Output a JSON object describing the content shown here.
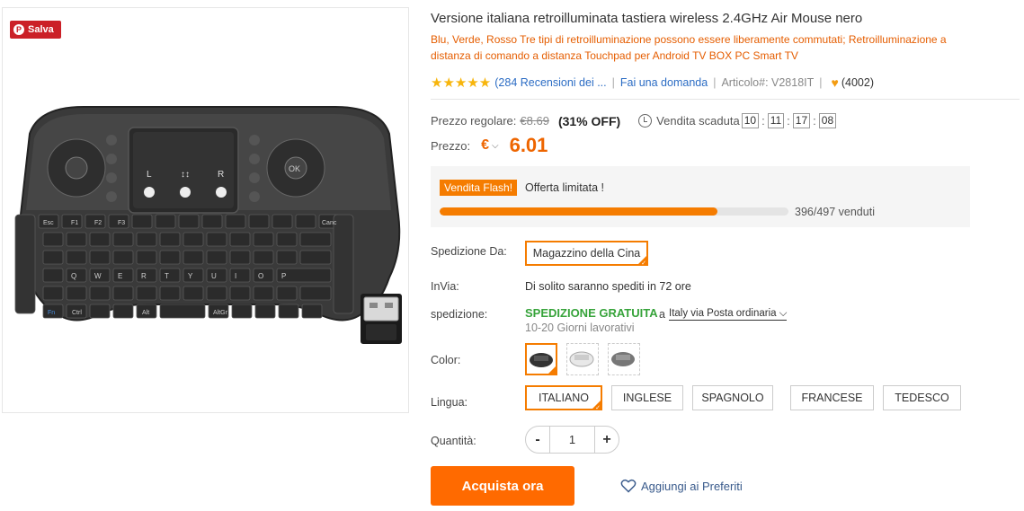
{
  "pin": {
    "label": "Salva",
    "icon": "pinterest-icon"
  },
  "product": {
    "title": "Versione italiana retroilluminata tastiera wireless 2.4GHz Air Mouse nero",
    "subtitle": "Blu, Verde, Rosso Tre tipi di retroilluminazione possono essere liberamente commutati; Retroilluminazione a distanza di comando a distanza Touchpad per Android TV BOX PC Smart TV",
    "stars": "★★★★★",
    "reviews": "(284 Recensioni dei ...",
    "ask": "Fai una domanda",
    "sku": "Articolo#: V2818IT",
    "favorites_count": "(4002)"
  },
  "pricing": {
    "regular_label": "Prezzo regolare:",
    "regular_price": "€8.69",
    "discount": "(31% OFF)",
    "countdown_label": "Vendita scaduta",
    "countdown": [
      "10",
      "11",
      "17",
      "08"
    ],
    "price_label": "Prezzo:",
    "currency": "€",
    "price": "6.01"
  },
  "flash": {
    "badge": "Vendita Flash!",
    "text": "Offerta limitata !",
    "sold": 396,
    "total": 497,
    "progress_text": "396/497  venduti"
  },
  "options": {
    "shipfrom_label": "Spedizione Da:",
    "shipfrom_value": "Magazzino della Cina",
    "invia_label": "InVia:",
    "invia_value": "Di solito saranno spediti in 72 ore",
    "shipping_label": "spedizione:",
    "shipping_free": "SPEDIZIONE GRATUITA",
    "shipping_a": "a",
    "shipping_method": "Italy via Posta ordinaria",
    "shipping_days": "10-20 Giorni lavorativi",
    "color_label": "Color:",
    "language_label": "Lingua:",
    "languages": [
      "ITALIANO",
      "INGLESE",
      "SPAGNOLO",
      "FRANCESE",
      "TEDESCO"
    ],
    "quantity_label": "Quantità:",
    "quantity": "1"
  },
  "actions": {
    "buy": "Acquista ora",
    "favorite": "Aggiungi ai Preferiti"
  },
  "colors": {
    "accent": "#ff6a00",
    "free_shipping": "#36a33a",
    "link": "#2b6cc4"
  }
}
